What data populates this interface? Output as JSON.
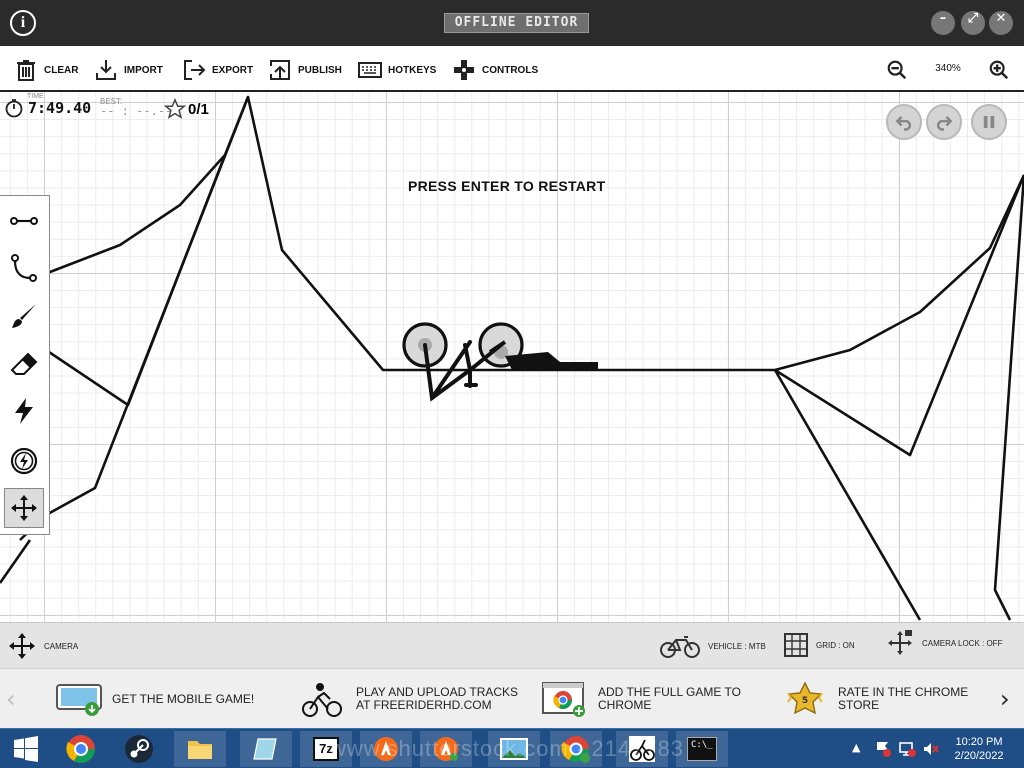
{
  "window": {
    "title": "OFFLINE EDITOR",
    "info_glyph": "i",
    "controls": [
      "minimize-icon",
      "maximize-icon",
      "close-icon"
    ]
  },
  "toolbar": {
    "items": [
      {
        "label": "CLEAR",
        "icon": "trash-icon"
      },
      {
        "label": "IMPORT",
        "icon": "import-icon"
      },
      {
        "label": "EXPORT",
        "icon": "export-icon"
      },
      {
        "label": "PUBLISH",
        "icon": "publish-icon"
      },
      {
        "label": "HOTKEYS",
        "icon": "keyboard-icon"
      },
      {
        "label": "CONTROLS",
        "icon": "dpad-icon"
      }
    ],
    "zoom": "340%"
  },
  "hud": {
    "time_label": "TIME",
    "time": "7:49.40",
    "best_label": "BEST:",
    "best": "-- : --.--",
    "stars": "0/1"
  },
  "message": "PRESS ENTER TO RESTART",
  "tools": [
    "line-tool-icon",
    "curve-tool-icon",
    "brush-tool-icon",
    "eraser-tool-icon",
    "boost-tool-icon",
    "powerup-tool-icon",
    "camera-tool-icon"
  ],
  "status": {
    "camera": "CAMERA",
    "vehicle": "VEHICLE : MTB",
    "grid": "GRID : ON",
    "camera_lock": "CAMERA LOCK : OFF"
  },
  "promos": [
    {
      "line1": "GET THE MOBILE GAME!",
      "line2": ""
    },
    {
      "line1": "PLAY AND UPLOAD TRACKS",
      "line2": "AT FREERIDERHD.COM"
    },
    {
      "line1": "ADD THE FULL GAME TO",
      "line2": "CHROME"
    },
    {
      "line1": "RATE IN THE CHROME",
      "line2": "STORE",
      "badge": "5"
    }
  ],
  "taskbar": {
    "apps": [
      "windows-start-icon",
      "chrome-icon",
      "steam-icon",
      "file-explorer-icon",
      "notepad-icon",
      "7zip-icon",
      "avast-icon",
      "avast-icon",
      "photos-icon",
      "chrome-app-icon",
      "free-rider-icon",
      "command-prompt-icon"
    ],
    "sevenzip_label": "7z",
    "cmd_label": "C:\\_",
    "time": "10:20 PM",
    "date": "2/20/2022"
  },
  "watermark": "www.shutterstock.com · 2147783"
}
